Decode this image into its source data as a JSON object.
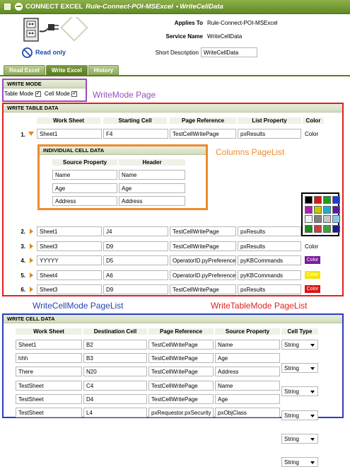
{
  "title": {
    "connect": "CONNECT EXCEL",
    "rule": "Rule-Connect-POI-MSExcel",
    "name": "WriteCellData"
  },
  "header": {
    "applies_to_label": "Applies To",
    "applies_to_value": "Rule-Connect-POI-MSExcel",
    "service_name_label": "Service Name",
    "service_name_value": "WriteCellData",
    "short_desc_label": "Short Description",
    "short_desc_value": "WriteCellData",
    "read_only": "Read only"
  },
  "tabs": [
    "Read Excel",
    "Write Excel",
    "History"
  ],
  "write_mode": {
    "title": "WRITE MODE",
    "table_mode": "Table Mode",
    "cell_mode": "Cell Mode"
  },
  "annotations": {
    "writemode_page": "WriteMode Page",
    "columns_pagelist": "Columns PageList",
    "writecellmode_pagelist": "WriteCellMode PageList",
    "writetablemode_pagelist": "WriteTableMode PageList"
  },
  "write_table": {
    "title": "WRITE TABLE DATA",
    "columns": [
      "Work Sheet",
      "Starting Cell",
      "Page Reference",
      "List Property",
      "Color"
    ],
    "rows": [
      {
        "num": "1.",
        "sheet": "Sheet1",
        "cell": "F4",
        "page": "TestCellWritePage",
        "list": "pxResults",
        "color": "Color",
        "swatch": ""
      },
      {
        "num": "2.",
        "sheet": "Sheet1",
        "cell": "J4",
        "page": "TestCellWritePage",
        "list": "pxResults",
        "color": "",
        "swatch": ""
      },
      {
        "num": "3.",
        "sheet": "Sheet3",
        "cell": "D9",
        "page": "TestCellWritePage",
        "list": "pxResults",
        "color": "Color",
        "swatch": ""
      },
      {
        "num": "4.",
        "sheet": "YYYYY",
        "cell": "D5",
        "page": "OperatorID.pyPreference",
        "list": "pyKBCommands",
        "color": "Color",
        "swatch": "#7a1c9e"
      },
      {
        "num": "5.",
        "sheet": "Sheet4",
        "cell": "A6",
        "page": "OperatorID.pyPreference",
        "list": "pyKBCommands",
        "color": "Color",
        "swatch": "#f4e400"
      },
      {
        "num": "6.",
        "sheet": "Sheet3",
        "cell": "D9",
        "page": "TestCellWritePage",
        "list": "pxResults",
        "color": "Color",
        "swatch": "#d81818"
      }
    ]
  },
  "individual_cell": {
    "title": "INDIVIDUAL CELL DATA",
    "columns": [
      "Source Property",
      "Header"
    ],
    "rows": [
      {
        "source": "Name",
        "header": "Name"
      },
      {
        "source": "Age",
        "header": "Age"
      },
      {
        "source": "Address",
        "header": "Address"
      }
    ]
  },
  "palette_colors": [
    "#000000",
    "#d81818",
    "#1aa01a",
    "#1c3cd8",
    "#b01cb0",
    "#c8c800",
    "#1cb0c8",
    "#5a1c9e",
    "#f0f0f0",
    "#808080",
    "#c8c8c8",
    "#88c8f0",
    "#1c8c1c",
    "#c84040",
    "#40a040",
    "#1c1c8c"
  ],
  "write_cell": {
    "title": "WRITE CELL DATA",
    "columns": [
      "Work Sheet",
      "Destination Cell",
      "Page Reference",
      "Source Property",
      "Cell Type"
    ],
    "rows": [
      {
        "sheet": "Sheet1",
        "dest": "B2",
        "page": "TestCellWritePage",
        "source": "Name",
        "type": "String"
      },
      {
        "sheet": "hhh",
        "dest": "B3",
        "page": "TestCellWritePage",
        "source": "Age",
        "type": "String"
      },
      {
        "sheet": "There",
        "dest": "N20",
        "page": "TestCellWritePage",
        "source": "Address",
        "type": "String"
      },
      {
        "sheet": "TestSheet",
        "dest": "C4",
        "page": "TestCellWritePage",
        "source": "Name",
        "type": "String"
      },
      {
        "sheet": "TestSheet",
        "dest": "D4",
        "page": "TestCellWritePage",
        "source": "Age",
        "type": "String"
      },
      {
        "sheet": "TestSheet",
        "dest": "L4",
        "page": "pxRequestor.pxSecurity",
        "source": "pxObjClass",
        "type": "String"
      }
    ]
  }
}
